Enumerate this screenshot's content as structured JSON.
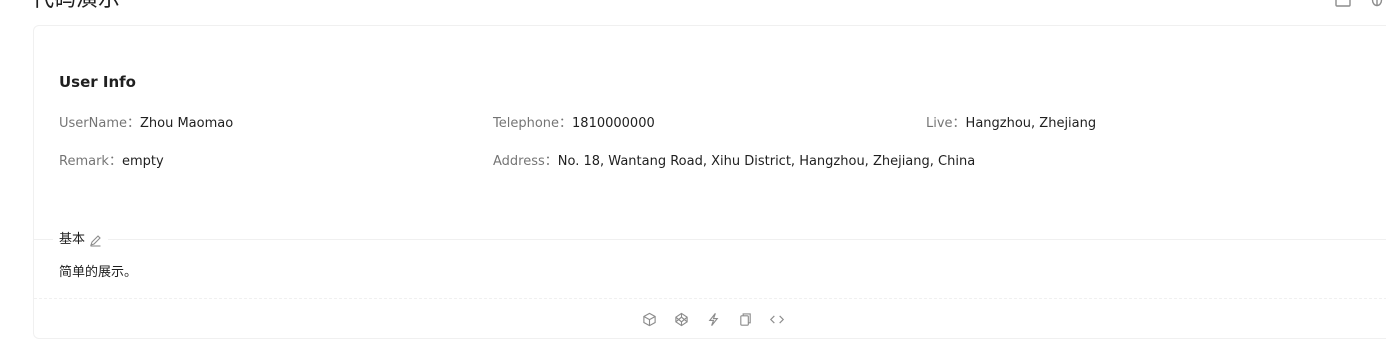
{
  "page": {
    "heading": "代码演示"
  },
  "demo": {
    "title": "User Info",
    "row1": [
      {
        "label": "UserName：",
        "value": "Zhou Maomao"
      },
      {
        "label": "Telephone：",
        "value": "1810000000"
      },
      {
        "label": "Live：",
        "value": "Hangzhou, Zhejiang"
      }
    ],
    "row2": [
      {
        "label": "Remark：",
        "value": "empty"
      },
      {
        "label": "Address：",
        "value": "No. 18, Wantang Road, Xihu District, Hangzhou, Zhejiang, China"
      }
    ]
  },
  "meta": {
    "title": "基本",
    "description": "简单的展示。"
  },
  "icons": {
    "top_actions": [
      "expand-icon",
      "bug-icon"
    ],
    "edit": "edit-icon",
    "code_actions": [
      "codesandbox-icon",
      "codepen-icon",
      "stackblitz-icon",
      "copy-icon",
      "code-expand-icon"
    ]
  },
  "colors": {
    "border": "#f0f0f0",
    "icon": "#8c8c8c"
  }
}
